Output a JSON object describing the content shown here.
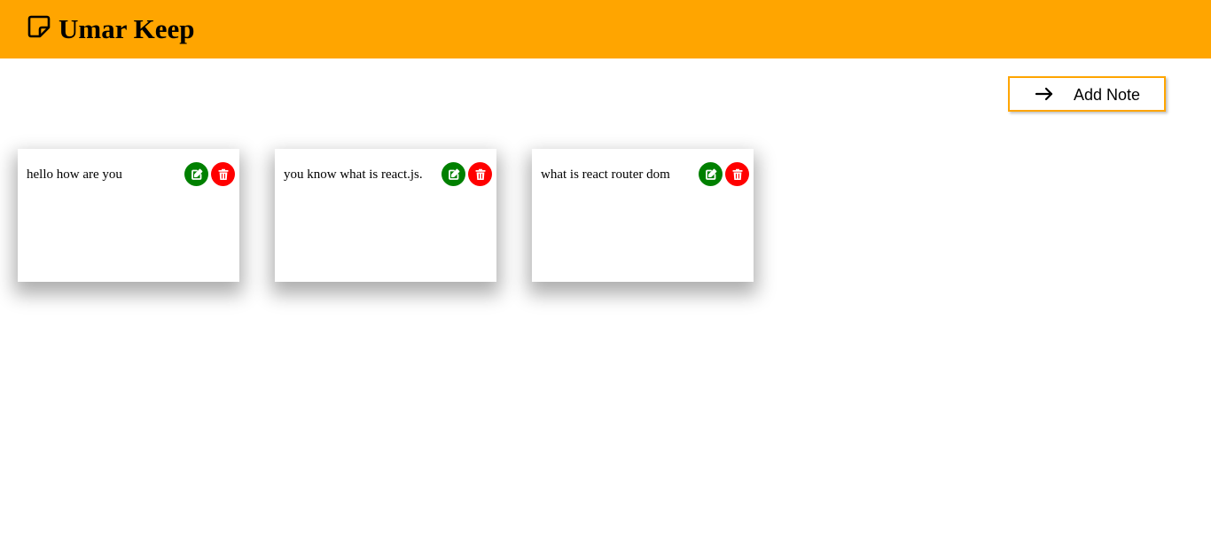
{
  "app": {
    "title": "Umar Keep",
    "logo_icon": "sticky-note-icon"
  },
  "toolbar": {
    "add_note_label": "Add Note",
    "add_note_icon": "arrow-right-icon"
  },
  "notes": [
    {
      "text": "hello how are you",
      "edit_icon": "edit-icon",
      "delete_icon": "trash-icon"
    },
    {
      "text": "you know what is react.js.",
      "edit_icon": "edit-icon",
      "delete_icon": "trash-icon"
    },
    {
      "text": "what is react router dom",
      "edit_icon": "edit-icon",
      "delete_icon": "trash-icon"
    }
  ],
  "colors": {
    "header_bg": "#FFA500",
    "button_border": "#FFA500",
    "edit_button": "#008000",
    "delete_button": "#FF0000",
    "icon_on_button": "#FFFFFF"
  }
}
